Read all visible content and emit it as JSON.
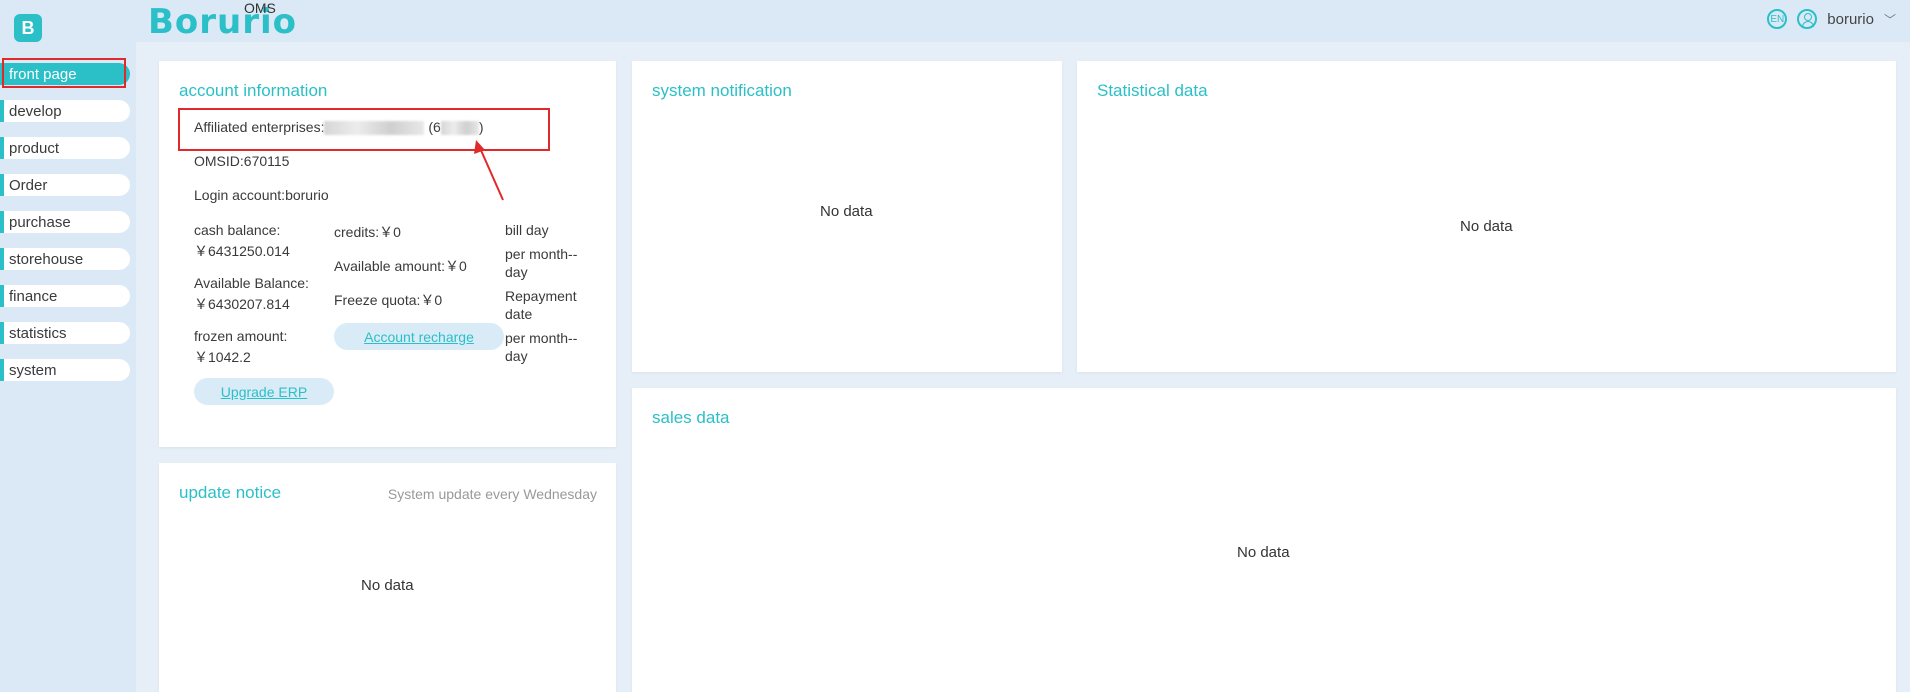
{
  "header": {
    "brand": "Borurio",
    "brand_sub": "OMS",
    "lang": "EN",
    "username": "borurio",
    "chevron": "﹀"
  },
  "sidebar": {
    "items": [
      {
        "label": "front page"
      },
      {
        "label": "develop"
      },
      {
        "label": "product"
      },
      {
        "label": "Order"
      },
      {
        "label": "purchase"
      },
      {
        "label": "storehouse"
      },
      {
        "label": "finance"
      },
      {
        "label": "statistics"
      },
      {
        "label": "system"
      }
    ],
    "active_index": 0
  },
  "account": {
    "title": "account information",
    "affiliated_label": "Affiliated enterprises:",
    "affiliated_paren_open": "(6",
    "affiliated_paren_close": ")",
    "omsid": "OMSID:670115",
    "login": "Login account:borurio",
    "cash_label": "cash balance:",
    "cash_value": "￥6431250.014",
    "available_label": "Available Balance:",
    "available_value": "￥6430207.814",
    "frozen_label": "frozen amount:",
    "frozen_value": "￥1042.2",
    "credits": "credits:￥0",
    "available_amount": "Available amount:￥0",
    "freeze_quota": "Freeze quota:￥0",
    "bill_day": "bill day",
    "per_month_day_1": "per month--day",
    "repayment_date": "Repayment date",
    "per_month_day_2": "per month--day",
    "recharge_btn": "Account recharge",
    "upgrade_btn": "Upgrade ERP"
  },
  "update_notice": {
    "title": "update notice",
    "subtitle": "System update every Wednesday",
    "empty": "No data"
  },
  "system_notification": {
    "title": "system notification",
    "empty": "No data"
  },
  "statistical_data": {
    "title": "Statistical data",
    "empty": "No data"
  },
  "sales_data": {
    "title": "sales data",
    "empty": "No data"
  },
  "colors": {
    "accent": "#2bbfc7",
    "highlight": "#e02a2a",
    "background": "#e6eff7"
  }
}
